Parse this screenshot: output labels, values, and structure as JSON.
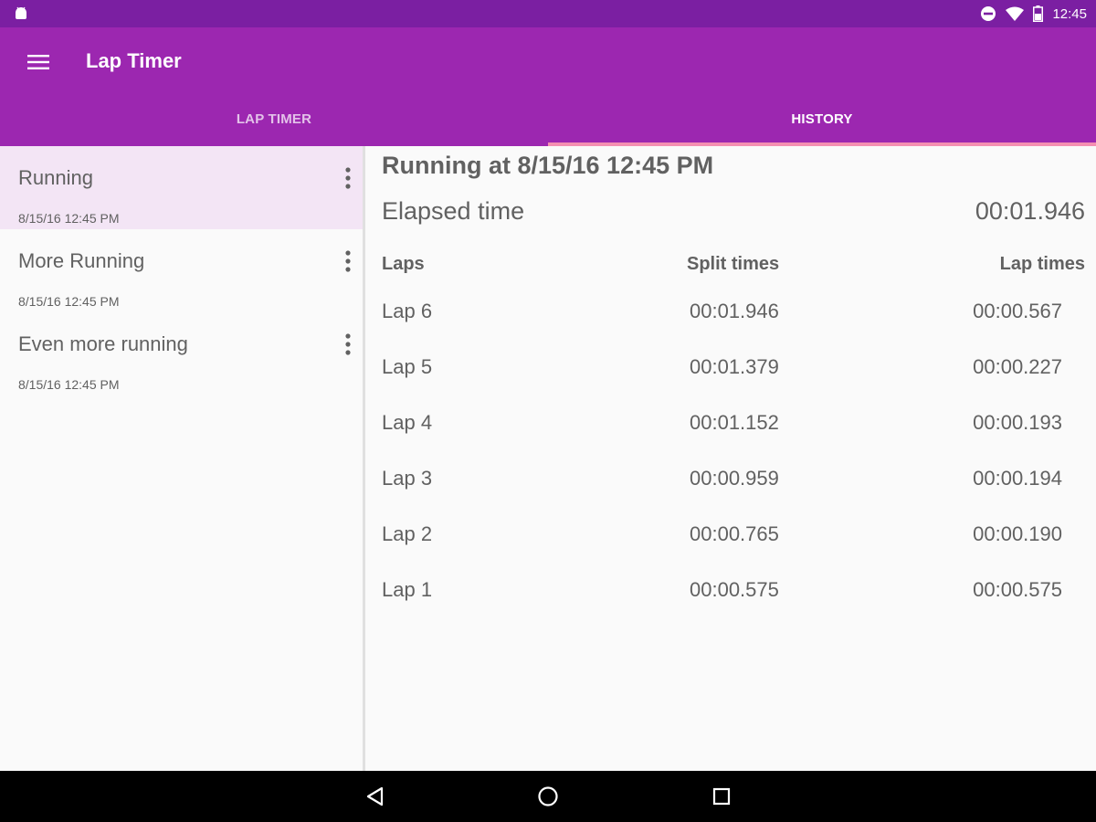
{
  "status_bar": {
    "time": "12:45",
    "icons": [
      "android-icon",
      "do-not-disturb-icon",
      "wifi-icon",
      "battery-icon"
    ]
  },
  "app_bar": {
    "title": "Lap Timer",
    "menu_icon": "hamburger-menu-icon",
    "background_color": "#9c27b0",
    "status_color": "#7b1fa2",
    "indicator_color": "#f48fb1"
  },
  "tabs": [
    {
      "label": "LAP TIMER",
      "active": false
    },
    {
      "label": "HISTORY",
      "active": true
    }
  ],
  "sessions": [
    {
      "title": "Running",
      "date": "8/15/16 12:45 PM",
      "selected": true
    },
    {
      "title": "More Running",
      "date": "8/15/16 12:45 PM",
      "selected": false
    },
    {
      "title": "Even more running",
      "date": "8/15/16 12:45 PM",
      "selected": false
    }
  ],
  "detail": {
    "title": "Running at 8/15/16 12:45 PM",
    "elapsed_label": "Elapsed time",
    "elapsed_value": "00:01.946",
    "headers": {
      "laps": "Laps",
      "split": "Split times",
      "lap": "Lap times"
    },
    "rows": [
      {
        "lap": "Lap 6",
        "split": "00:01.946",
        "lap_time": "00:00.567"
      },
      {
        "lap": "Lap 5",
        "split": "00:01.379",
        "lap_time": "00:00.227"
      },
      {
        "lap": "Lap 4",
        "split": "00:01.152",
        "lap_time": "00:00.193"
      },
      {
        "lap": "Lap 3",
        "split": "00:00.959",
        "lap_time": "00:00.194"
      },
      {
        "lap": "Lap 2",
        "split": "00:00.765",
        "lap_time": "00:00.190"
      },
      {
        "lap": "Lap 1",
        "split": "00:00.575",
        "lap_time": "00:00.575"
      }
    ]
  },
  "nav_bar": {
    "icons": [
      "back-icon",
      "home-icon",
      "recents-icon"
    ]
  }
}
